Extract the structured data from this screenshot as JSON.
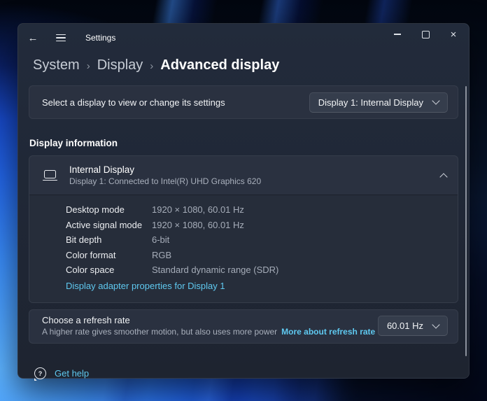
{
  "window": {
    "app_title": "Settings",
    "titlebar": {
      "back_icon": "←",
      "close_icon": "×"
    }
  },
  "breadcrumb": {
    "separator": "›",
    "items": [
      {
        "label": "System"
      },
      {
        "label": "Display"
      },
      {
        "label": "Advanced display"
      }
    ]
  },
  "display_selector": {
    "label": "Select a display to view or change its settings",
    "value": "Display 1: Internal Display"
  },
  "section": {
    "title": "Display information"
  },
  "display_info": {
    "title": "Internal Display",
    "subtitle": "Display 1: Connected to Intel(R) UHD Graphics 620",
    "rows": [
      {
        "label": "Desktop mode",
        "value": "1920 × 1080, 60.01 Hz"
      },
      {
        "label": "Active signal mode",
        "value": "1920 × 1080, 60.01 Hz"
      },
      {
        "label": "Bit depth",
        "value": "6-bit"
      },
      {
        "label": "Color format",
        "value": "RGB"
      },
      {
        "label": "Color space",
        "value": "Standard dynamic range (SDR)"
      }
    ],
    "adapter_link": "Display adapter properties for Display 1"
  },
  "refresh_rate": {
    "title": "Choose a refresh rate",
    "description": "A higher rate gives smoother motion, but also uses more power",
    "link": "More about refresh rate",
    "value": "60.01 Hz"
  },
  "footer": {
    "get_help": "Get help"
  },
  "colors": {
    "accent_link": "#5fc9f0",
    "window_bg": "#1f2634",
    "card_bg": "#2a3140",
    "wallpaper_blue": "#3a8cf6"
  }
}
